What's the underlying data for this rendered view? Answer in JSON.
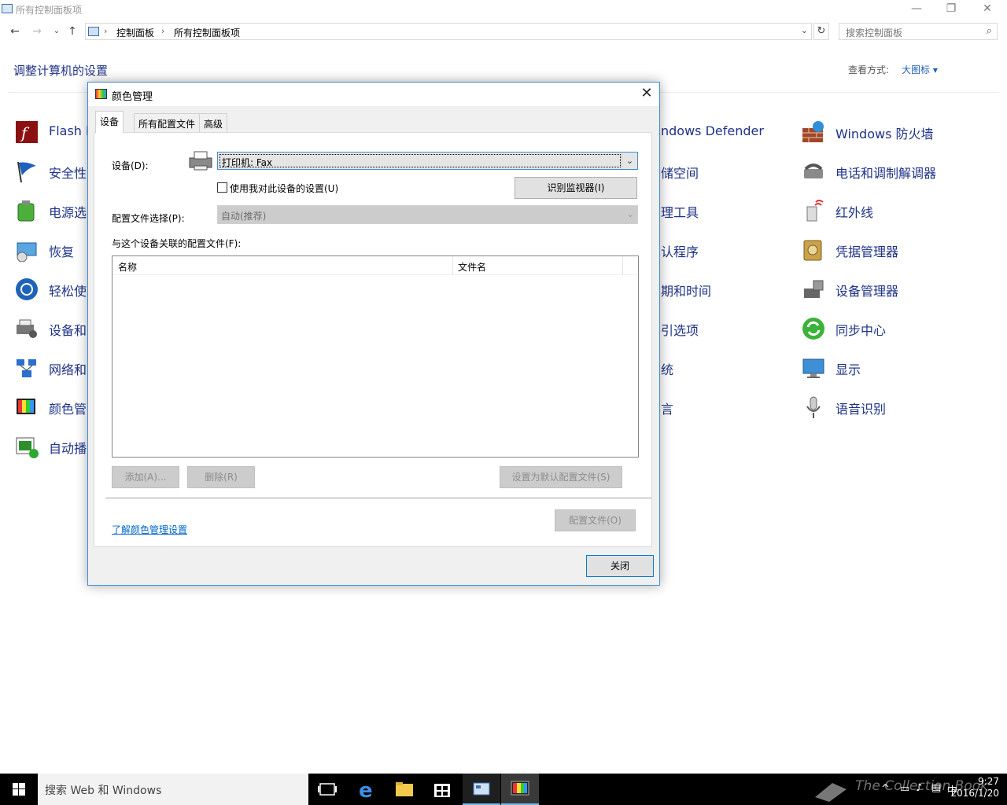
{
  "window": {
    "title": "所有控制面板项",
    "controls": {
      "minimize": "—",
      "restore": "❐",
      "close": "✕"
    }
  },
  "nav": {
    "back": "←",
    "forward": "→",
    "recent": "⌄",
    "up": "↑",
    "crumbs": [
      "控制面板",
      "所有控制面板项"
    ],
    "refresh": "↻",
    "search_placeholder": "搜索控制面板"
  },
  "main": {
    "heading": "调整计算机的设置",
    "view_by_label": "查看方式:",
    "view_by_value": "大图标 ▾",
    "items_left": [
      {
        "label": "Flash P",
        "icon": "flash-icon"
      },
      {
        "label": "安全性",
        "icon": "flag-icon"
      },
      {
        "label": "电源选",
        "icon": "battery-icon"
      },
      {
        "label": "恢复",
        "icon": "recovery-icon"
      },
      {
        "label": "轻松使",
        "icon": "ease-of-access-icon"
      },
      {
        "label": "设备和",
        "icon": "devices-printers-icon"
      },
      {
        "label": "网络和",
        "icon": "network-icon"
      },
      {
        "label": "颜色管",
        "icon": "color-management-icon"
      },
      {
        "label": "自动播",
        "icon": "autoplay-icon"
      }
    ],
    "items_mid": [
      {
        "label": "ndows Defender"
      },
      {
        "label": "储空间"
      },
      {
        "label": "理工具"
      },
      {
        "label": "认程序"
      },
      {
        "label": "期和时间"
      },
      {
        "label": "引选项"
      },
      {
        "label": "统"
      },
      {
        "label": "言"
      }
    ],
    "items_right": [
      {
        "label": "Windows 防火墙",
        "icon": "firewall-icon"
      },
      {
        "label": "电话和调制解调器",
        "icon": "phone-modem-icon"
      },
      {
        "label": "红外线",
        "icon": "infrared-icon"
      },
      {
        "label": "凭据管理器",
        "icon": "credential-icon"
      },
      {
        "label": "设备管理器",
        "icon": "device-manager-icon"
      },
      {
        "label": "同步中心",
        "icon": "sync-icon"
      },
      {
        "label": "显示",
        "icon": "display-icon"
      },
      {
        "label": "语音识别",
        "icon": "microphone-icon"
      }
    ]
  },
  "dialog": {
    "title": "颜色管理",
    "close": "✕",
    "tabs": [
      "设备",
      "所有配置文件",
      "高级"
    ],
    "device_label": "设备(D):",
    "device_value": "打印机: Fax",
    "use_my_settings": "使用我对此设备的设置(U)",
    "identify_monitors": "识别监视器(I)",
    "profile_selection_label": "配置文件选择(P):",
    "profile_selection_value": "自动(推荐)",
    "associated_label": "与这个设备关联的配置文件(F):",
    "columns": [
      "名称",
      "文件名"
    ],
    "add": "添加(A)...",
    "remove": "删除(R)",
    "set_default": "设置为默认配置文件(S)",
    "learn_link": "了解颜色管理设置",
    "profiles_button": "配置文件(O)",
    "close_button": "关闭"
  },
  "taskbar": {
    "search_placeholder": "搜索 Web 和 Windows",
    "time": "9:27",
    "date": "2016/1/20",
    "tray_lang": "中",
    "watermark": "The Collection Book"
  }
}
